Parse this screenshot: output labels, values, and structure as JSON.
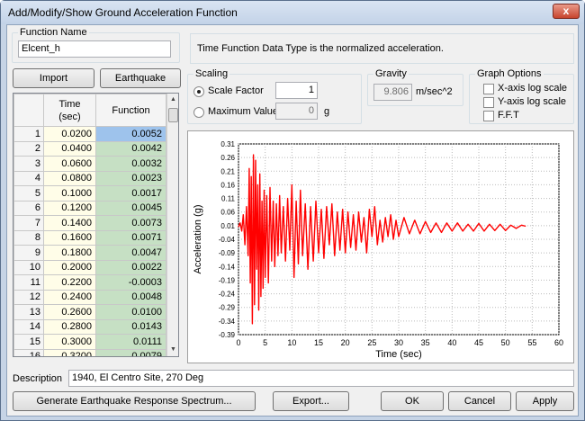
{
  "window": {
    "title": "Add/Modify/Show Ground Acceleration Function",
    "close_label": "x"
  },
  "function_name": {
    "label": "Function Name",
    "value": "Elcent_h"
  },
  "info_text": "Time Function Data Type is the normalized acceleration.",
  "buttons": {
    "import": "Import",
    "earthquake": "Earthquake"
  },
  "scaling": {
    "label": "Scaling",
    "scale_factor_label": "Scale Factor",
    "scale_factor_value": "1",
    "max_value_label": "Maximum Value",
    "max_value_value": "0",
    "max_value_unit": "g"
  },
  "gravity": {
    "label": "Gravity",
    "value": "9.806",
    "unit": "m/sec^2"
  },
  "graph_options": {
    "label": "Graph Options",
    "x_log": "X-axis log scale",
    "y_log": "Y-axis log scale",
    "fft": "F.F.T"
  },
  "table": {
    "headers": {
      "time": "Time\n(sec)",
      "function": "Function"
    },
    "rows": [
      [
        "1",
        "0.0200",
        "0.0052"
      ],
      [
        "2",
        "0.0400",
        "0.0042"
      ],
      [
        "3",
        "0.0600",
        "0.0032"
      ],
      [
        "4",
        "0.0800",
        "0.0023"
      ],
      [
        "5",
        "0.1000",
        "0.0017"
      ],
      [
        "6",
        "0.1200",
        "0.0045"
      ],
      [
        "7",
        "0.1400",
        "0.0073"
      ],
      [
        "8",
        "0.1600",
        "0.0071"
      ],
      [
        "9",
        "0.1800",
        "0.0047"
      ],
      [
        "10",
        "0.2000",
        "0.0022"
      ],
      [
        "11",
        "0.2200",
        "-0.0003"
      ],
      [
        "12",
        "0.2400",
        "0.0048"
      ],
      [
        "13",
        "0.2600",
        "0.0100"
      ],
      [
        "14",
        "0.2800",
        "0.0143"
      ],
      [
        "15",
        "0.3000",
        "0.0111"
      ],
      [
        "16",
        "0.3200",
        "0.0079"
      ]
    ]
  },
  "chart_data": {
    "type": "line",
    "xlabel": "Time (sec)",
    "ylabel": "Acceleration (g)",
    "xlim": [
      0,
      60
    ],
    "ylim": [
      -0.39,
      0.31
    ],
    "xticks": [
      "0",
      "5",
      "10",
      "15",
      "20",
      "25",
      "30",
      "35",
      "40",
      "45",
      "50",
      "55",
      "60"
    ],
    "yticks": [
      "0.31",
      "0.26",
      "0.21",
      "0.16",
      "0.11",
      "0.06",
      "0.01",
      "-0.04",
      "-0.09",
      "-0.14",
      "-0.19",
      "-0.24",
      "-0.29",
      "-0.34",
      "-0.39"
    ],
    "grid": true,
    "series_color": "#ff0000",
    "series": [
      {
        "x": [
          0,
          0.3,
          0.6,
          0.9,
          1.2,
          1.5,
          1.8,
          2.0,
          2.2,
          2.4,
          2.6,
          2.8,
          3.0,
          3.2,
          3.4,
          3.6,
          3.8,
          4.0,
          4.2,
          4.4,
          4.6,
          4.8,
          5.0,
          5.3,
          5.6,
          5.9,
          6.2,
          6.5,
          6.8,
          7.1,
          7.4,
          7.7,
          8.0,
          8.4,
          8.8,
          9.2,
          9.6,
          10.0,
          10.4,
          10.8,
          11.2,
          11.6,
          12.0,
          12.5,
          13.0,
          13.5,
          14.0,
          14.5,
          15.0,
          15.5,
          16.0,
          16.5,
          17.0,
          17.5,
          18.0,
          18.5,
          19.0,
          19.5,
          20.0,
          20.5,
          21.0,
          21.5,
          22.0,
          22.5,
          23.0,
          23.5,
          24.0,
          24.5,
          25.0,
          25.5,
          26.0,
          26.5,
          27.0,
          27.5,
          28.0,
          28.5,
          29.0,
          29.5,
          30.0,
          31,
          32,
          33,
          34,
          35,
          36,
          37,
          38,
          39,
          40,
          41,
          42,
          43,
          44,
          45,
          46,
          47,
          48,
          49,
          50,
          51,
          52,
          53,
          53.8
        ],
        "y": [
          0.005,
          0.02,
          -0.01,
          0.05,
          -0.06,
          0.08,
          -0.1,
          0.22,
          -0.2,
          0.19,
          -0.35,
          0.27,
          -0.28,
          0.25,
          -0.15,
          0.16,
          -0.3,
          0.2,
          -0.25,
          0.1,
          -0.22,
          0.14,
          -0.18,
          0.12,
          -0.2,
          0.15,
          -0.12,
          0.1,
          -0.14,
          0.09,
          -0.1,
          0.12,
          -0.09,
          0.08,
          -0.12,
          0.11,
          -0.08,
          0.16,
          -0.18,
          0.1,
          -0.13,
          0.14,
          -0.1,
          0.09,
          -0.15,
          0.08,
          -0.12,
          0.1,
          -0.09,
          0.07,
          -0.11,
          0.08,
          -0.06,
          0.09,
          -0.1,
          0.06,
          -0.08,
          0.07,
          -0.09,
          0.06,
          -0.07,
          0.05,
          -0.08,
          0.06,
          -0.05,
          0.04,
          -0.09,
          0.07,
          -0.03,
          0.08,
          -0.06,
          0.03,
          -0.05,
          0.04,
          -0.03,
          0.05,
          -0.04,
          0.03,
          -0.03,
          0.04,
          -0.02,
          0.03,
          -0.02,
          0.025,
          -0.015,
          0.02,
          -0.015,
          0.02,
          -0.01,
          0.02,
          -0.01,
          0.015,
          -0.01,
          0.018,
          -0.01,
          0.015,
          -0.008,
          0.015,
          -0.008,
          0.012,
          0.0,
          0.012,
          0.008
        ]
      }
    ]
  },
  "description": {
    "label": "Description",
    "value": "1940, El Centro Site, 270 Deg"
  },
  "footer": {
    "spectrum": "Generate Earthquake Response Spectrum...",
    "export": "Export...",
    "ok": "OK",
    "cancel": "Cancel",
    "apply": "Apply"
  }
}
